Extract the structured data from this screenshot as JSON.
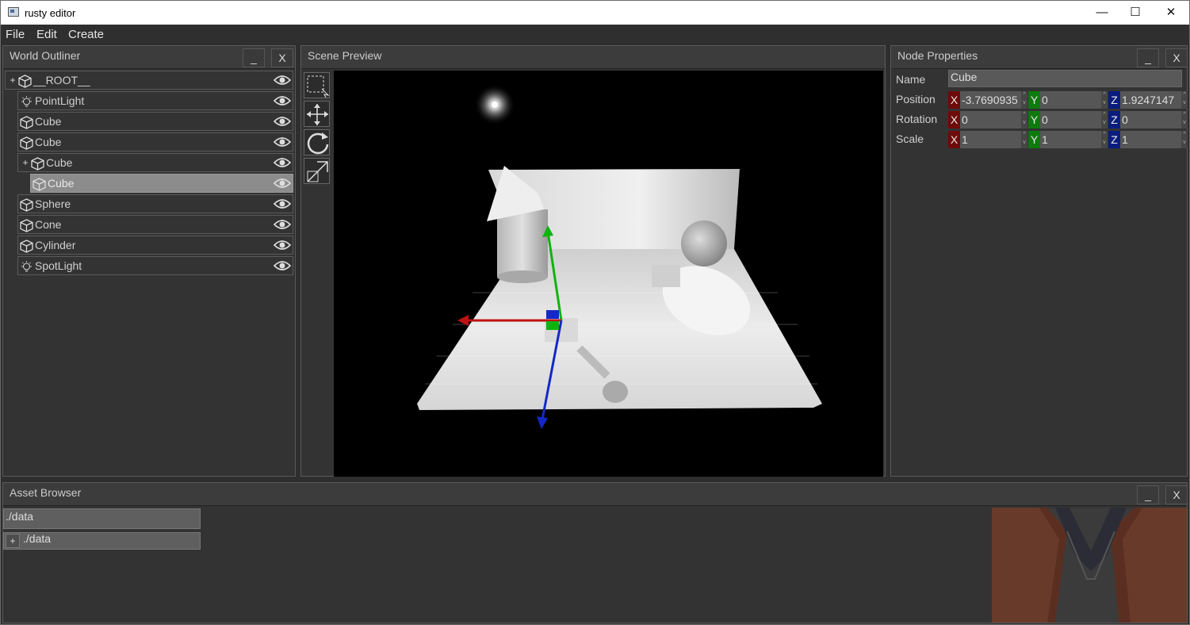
{
  "window": {
    "title": "rusty editor",
    "controls": {
      "minimize": "—",
      "maximize": "☐",
      "close": "✕"
    }
  },
  "menu": [
    "File",
    "Edit",
    "Create"
  ],
  "world_outliner": {
    "title": "World Outliner",
    "minimize_label": "_",
    "close_label": "X",
    "expand_label": "+",
    "nodes": [
      {
        "label": "__ROOT__",
        "icon": "cube-icon",
        "expandable": true
      },
      {
        "label": "PointLight",
        "icon": "light-bulb-icon"
      },
      {
        "label": "Cube",
        "icon": "cube-icon"
      },
      {
        "label": "Cube",
        "icon": "cube-icon"
      },
      {
        "label": "Cube",
        "icon": "cube-icon",
        "expandable": true
      },
      {
        "label": "Cube",
        "icon": "cube-icon",
        "selected": true
      },
      {
        "label": "Sphere",
        "icon": "cube-icon"
      },
      {
        "label": "Cone",
        "icon": "cube-icon"
      },
      {
        "label": "Cylinder",
        "icon": "cube-icon"
      },
      {
        "label": "SpotLight",
        "icon": "light-bulb-icon"
      }
    ]
  },
  "scene_preview": {
    "title": "Scene Preview",
    "tools": [
      "select-tool-icon",
      "move-tool-icon",
      "rotate-tool-icon",
      "scale-tool-icon"
    ]
  },
  "node_properties": {
    "title": "Node Properties",
    "minimize_label": "_",
    "close_label": "X",
    "name_label": "Name",
    "name_value": "Cube",
    "position": {
      "label": "Position",
      "x": "-3.7690935",
      "y": "0",
      "z": "1.9247147"
    },
    "rotation": {
      "label": "Rotation",
      "x": "0",
      "y": "0",
      "z": "0"
    },
    "scale": {
      "label": "Scale",
      "x": "1",
      "y": "1",
      "z": "1"
    },
    "axis_labels": {
      "x": "X",
      "y": "Y",
      "z": "Z"
    },
    "spin_up": "^",
    "spin_down": "v"
  },
  "asset_browser": {
    "title": "Asset Browser",
    "minimize_label": "_",
    "close_label": "X",
    "path": "./data",
    "tree_root": "./data",
    "expand_label": "+"
  },
  "colors": {
    "axis_x": "#6e0b0b",
    "axis_y": "#0e7a0e",
    "axis_z": "#0a1d7e",
    "selection": "#8c8c8c"
  }
}
